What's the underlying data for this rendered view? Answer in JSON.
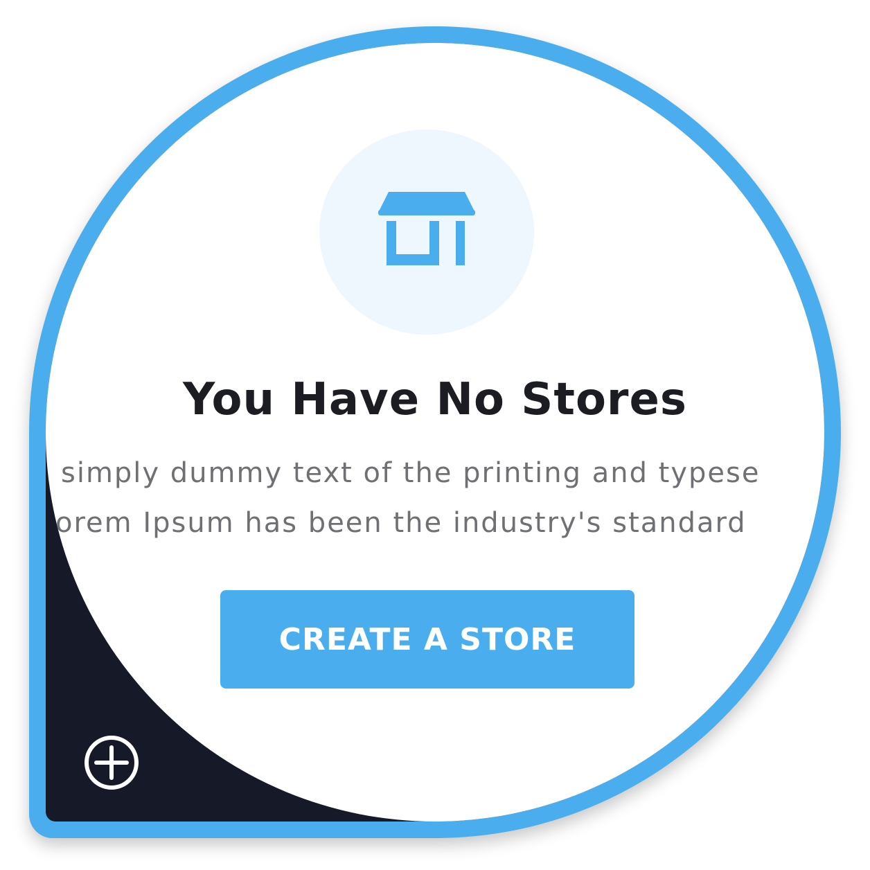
{
  "empty_state": {
    "title": "You Have No Stores",
    "description_line1": "simply dummy text of the printing and typese",
    "description_line2": "orem Ipsum has been the industry's standard",
    "cta_label": "CREATE A STORE",
    "icon": "store-icon"
  },
  "corner": {
    "icon": "add-circle-icon"
  },
  "colors": {
    "accent": "#4aaeee",
    "icon_bg": "#eff7fe",
    "dark_corner": "#161927",
    "title_text": "#1c1d23",
    "body_text": "#6f7073"
  }
}
